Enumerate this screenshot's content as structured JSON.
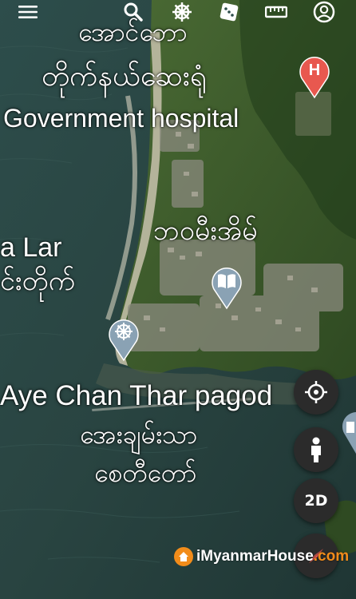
{
  "toolbar": {
    "icons": [
      "menu-icon",
      "search-icon",
      "dharma-wheel-icon",
      "dice-icon",
      "ruler-icon",
      "account-icon"
    ]
  },
  "labels": {
    "village_mm": "အောင်ဘော",
    "hospital_mm": "တိုက်နယ်ဆေးရုံ",
    "hospital_en": "Government hospital",
    "area_mm": "ဘဝမီးအိမ်",
    "left_en": "a Lar",
    "left_mm": "င်းတိုက်",
    "pagoda_en": "Aye Chan Thar pagod",
    "pagoda_mm_1": "အေးချမ်းသာ",
    "pagoda_mm_2": "စေတီတော်"
  },
  "controls": {
    "mode_label": "2D"
  },
  "watermark": {
    "prefix": "i",
    "main": "MyanmarHouse",
    "suffix": ".com"
  },
  "colors": {
    "sea": "#2c4a46",
    "land": "#3f5a2c",
    "beach": "#bdb7a2",
    "pin_blue": "#8aa2b4",
    "hospital_red": "#e8584f",
    "brand_orange": "#f28c1a"
  }
}
